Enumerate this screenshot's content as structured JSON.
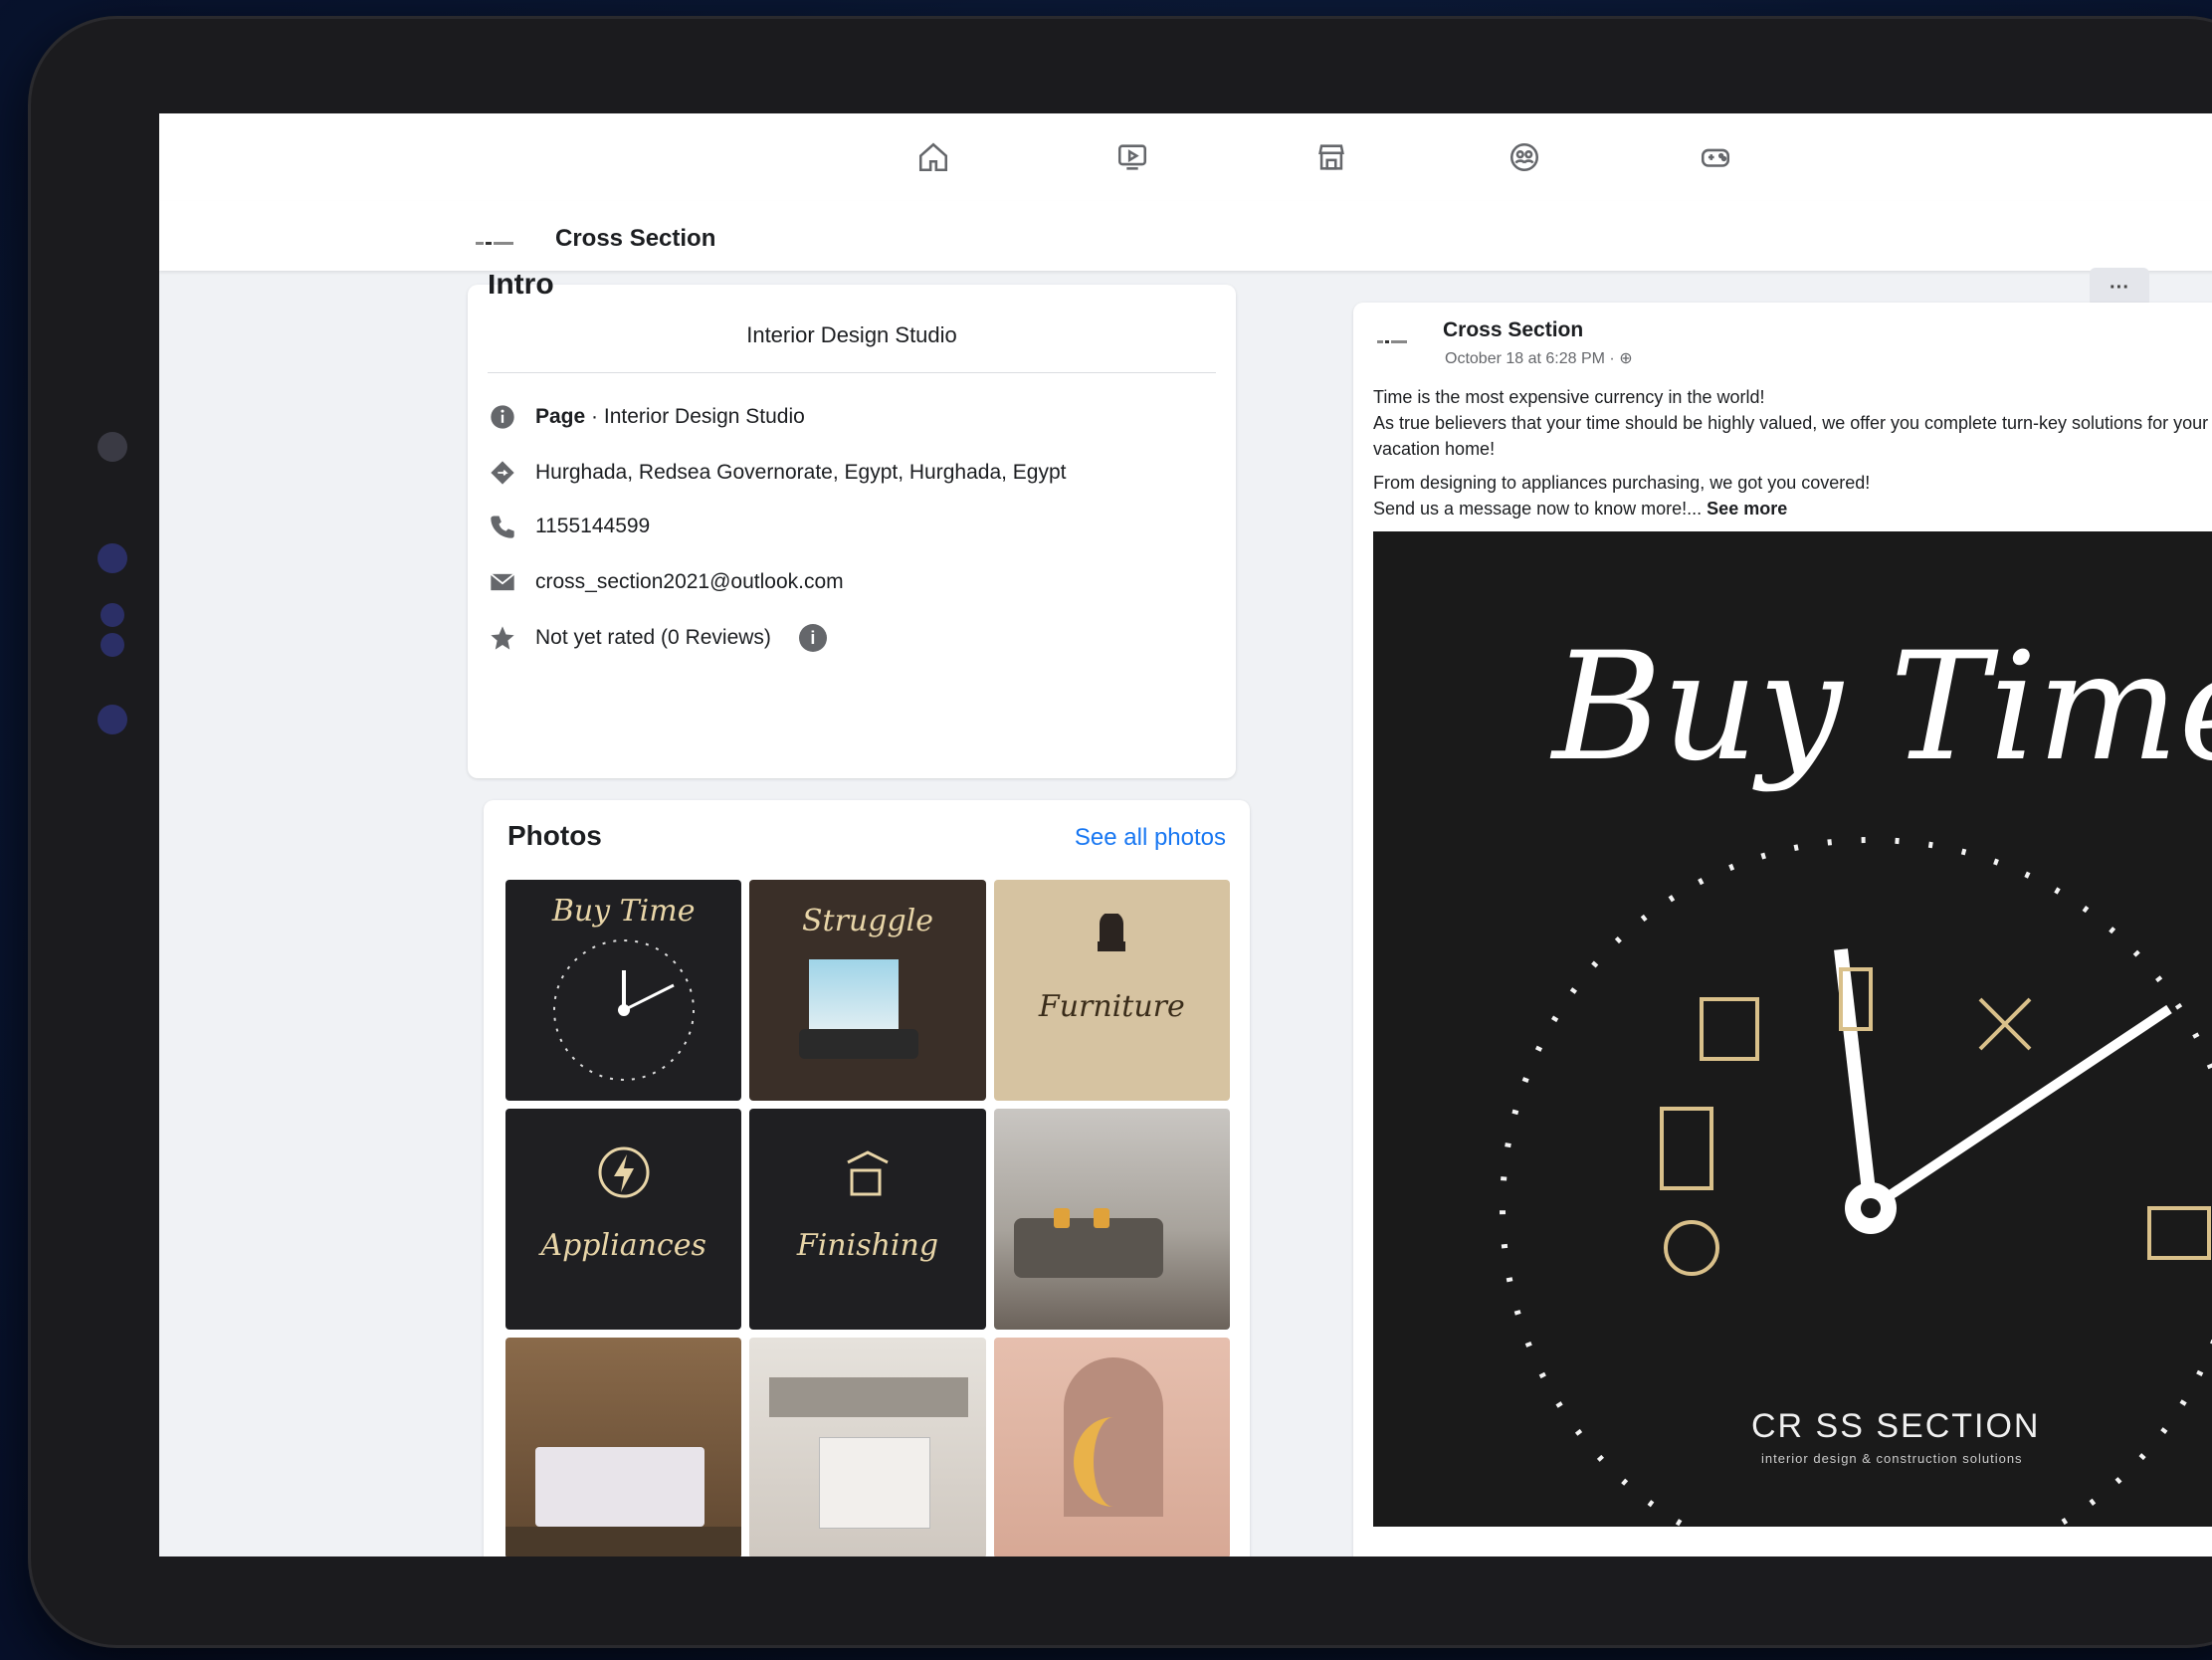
{
  "page": {
    "name": "Cross Section"
  },
  "topbar": {
    "icons": [
      "home-icon",
      "watch-icon",
      "marketplace-icon",
      "groups-icon",
      "gaming-icon"
    ]
  },
  "intro": {
    "heading": "Intro",
    "bio": "Interior Design Studio",
    "rows": [
      {
        "icon": "info-icon",
        "label_bold": "Page",
        "label": " · Interior Design Studio"
      },
      {
        "icon": "location-icon",
        "label": "Hurghada, Redsea Governorate, Egypt, Hurghada, Egypt"
      },
      {
        "icon": "phone-icon",
        "label": "1155144599"
      },
      {
        "icon": "email-icon",
        "label": "cross_section2021@outlook.com"
      },
      {
        "icon": "star-icon",
        "label": "Not yet rated (0 Reviews)"
      }
    ]
  },
  "photos": {
    "heading": "Photos",
    "see_all": "See all photos",
    "items": [
      {
        "caption": "Buy Time",
        "style": "dark"
      },
      {
        "caption": "Struggle",
        "style": "dark"
      },
      {
        "caption": "Furniture",
        "style": "tan"
      },
      {
        "caption": "Appliances",
        "style": "dark"
      },
      {
        "caption": "Finishing",
        "style": "dark"
      },
      {
        "caption": "",
        "style": "room"
      },
      {
        "caption": "",
        "style": "bedroom"
      },
      {
        "caption": "",
        "style": "kitchen"
      },
      {
        "caption": "",
        "style": "pink"
      }
    ]
  },
  "post": {
    "author": "Cross Section",
    "time": "October 18 at 6:28 PM · ",
    "more": "···",
    "text1": "Time is the most expensive currency in the world!",
    "text2": "As true believers that your time should be highly valued, we offer you complete turn-key solutions for your vacation home!",
    "text3": "From designing to appliances purchasing, we got you covered!",
    "text4": "Send us a message now to know more!... ",
    "see_more": "See more",
    "image_title": "Buy Time",
    "brand": "CR  SS SECTION",
    "brand_sub": "interior design & construction solutions"
  },
  "header_more": "···",
  "colors": {
    "link": "#1877f2",
    "gold": "#e8d5a8"
  }
}
